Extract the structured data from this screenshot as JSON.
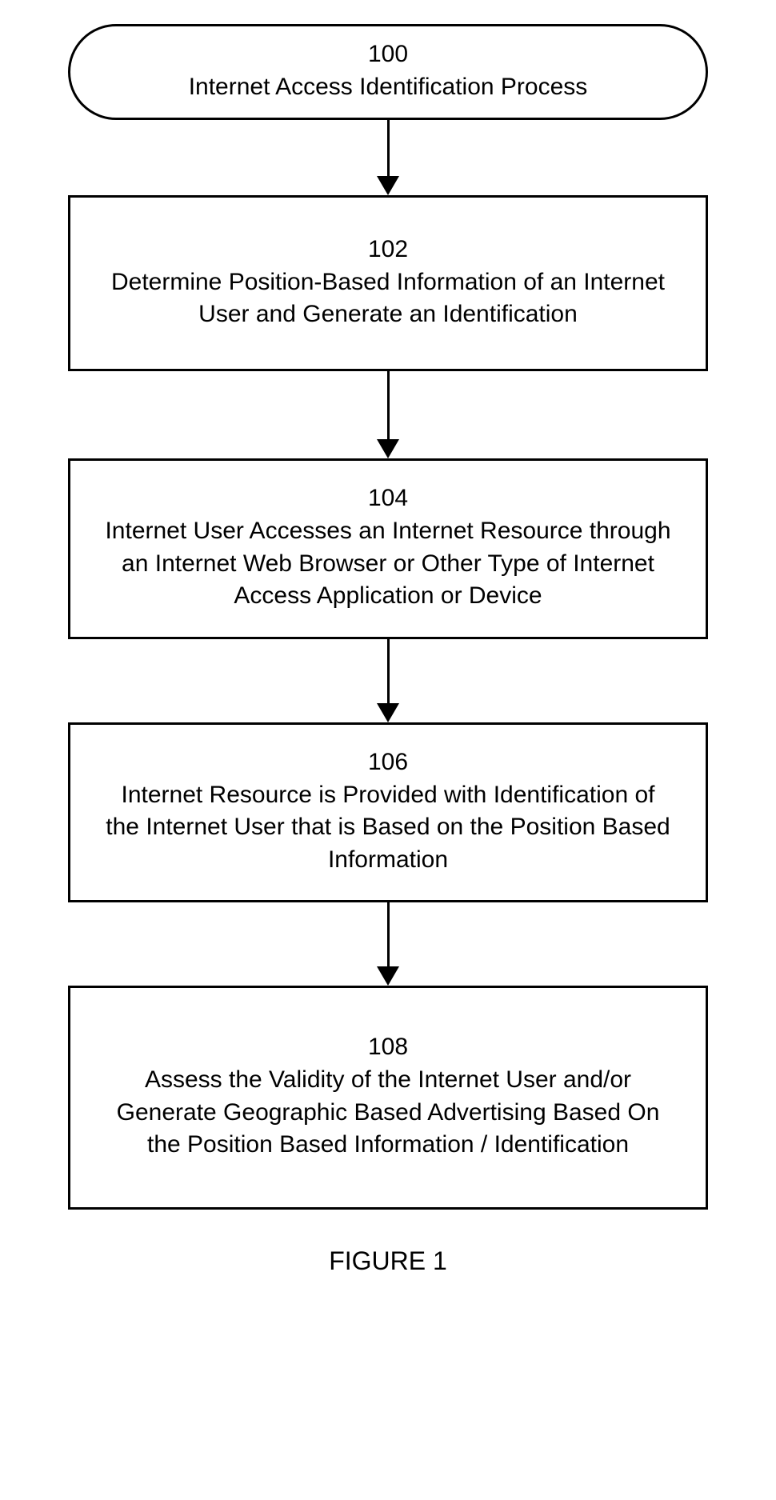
{
  "flowchart": {
    "steps": [
      {
        "number": "100",
        "text": "Internet Access Identification Process"
      },
      {
        "number": "102",
        "text": "Determine Position-Based Information of an Internet User and Generate an Identification"
      },
      {
        "number": "104",
        "text": "Internet User Accesses an Internet Resource through an Internet Web Browser or Other Type of Internet Access Application or Device"
      },
      {
        "number": "106",
        "text": "Internet Resource is Provided with Identification of the Internet User that is Based on the Position Based Information"
      },
      {
        "number": "108",
        "text": "Assess the Validity of the Internet User   and/or Generate Geographic Based Advertising Based On the Position Based Information / Identification"
      }
    ],
    "figure_label": "FIGURE 1"
  }
}
